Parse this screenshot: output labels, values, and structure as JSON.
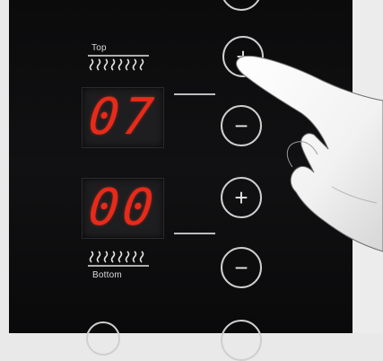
{
  "top_label": "Top",
  "bottom_label": "Bottom",
  "top_display": "07",
  "bottom_display": "00",
  "buttons": {
    "plus": "+",
    "minus": "−"
  },
  "colors": {
    "panel": "#0b0b0c",
    "digits": "#e82a1a",
    "outline": "#cfcfcf"
  },
  "icons": [
    "heating-element-icon",
    "hand-pointer-icon"
  ]
}
